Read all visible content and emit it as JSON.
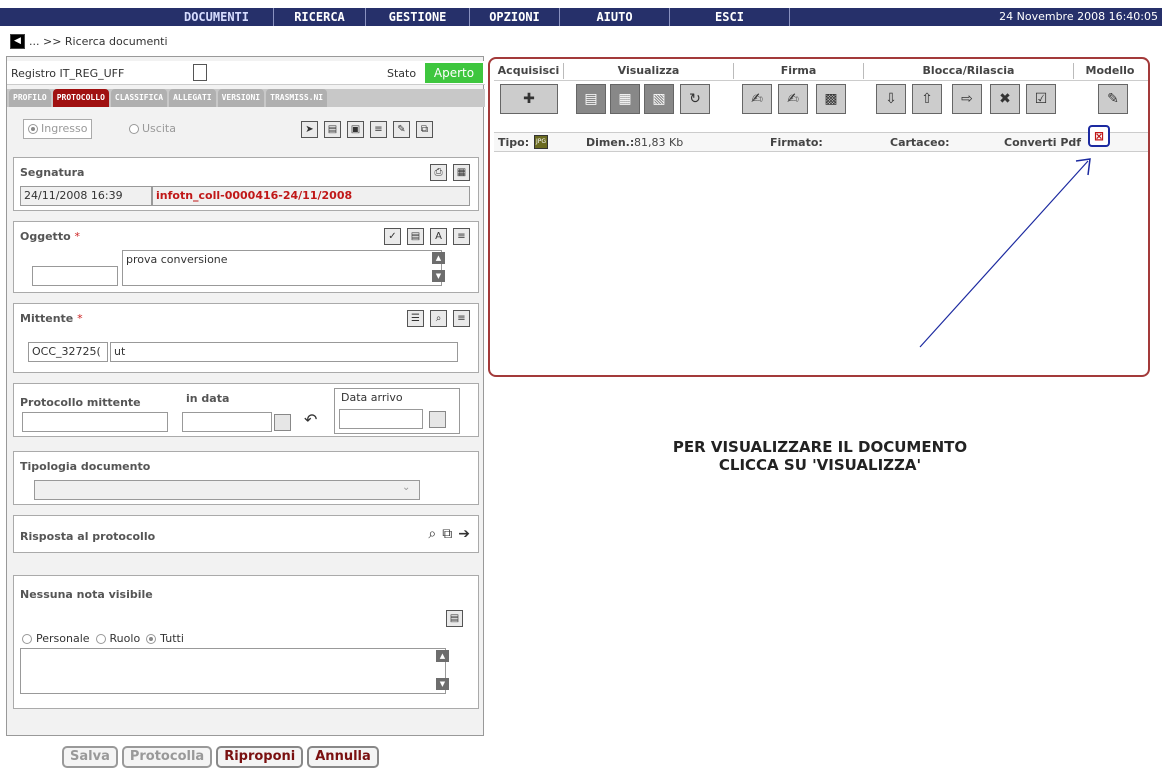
{
  "menu": {
    "items": [
      "DOCUMENTI",
      "RICERCA",
      "GESTIONE",
      "OPZIONI",
      "AIUTO",
      "ESCI"
    ],
    "date": "24 Novembre 2008 16:40:05"
  },
  "breadcrumb": "... >> Ricerca documenti",
  "register": {
    "label": "Registro IT_REG_UFF",
    "stato_label": "Stato",
    "stato_value": "Aperto"
  },
  "tabs": [
    "PROFILO",
    "PROTOCOLLO",
    "CLASSIFICA",
    "ALLEGATI",
    "VERSIONI",
    "TRASMISS.NI"
  ],
  "direction": {
    "ingresso": "Ingresso",
    "uscita": "Uscita"
  },
  "segnatura": {
    "title": "Segnatura",
    "date": "24/11/2008 16:39",
    "code": "infotn_coll-0000416-24/11/2008"
  },
  "oggetto": {
    "title": "Oggetto",
    "required": "*",
    "value": "prova conversione"
  },
  "mittente": {
    "title": "Mittente",
    "required": "*",
    "code": "OCC_32725(",
    "name": "ut"
  },
  "protocollo_mittente": {
    "title": "Protocollo mittente",
    "in_data": "in data",
    "data_arrivo": "Data arrivo"
  },
  "tipologia": {
    "title": "Tipologia documento"
  },
  "risposta": {
    "title": "Risposta al protocollo"
  },
  "note": {
    "title": "Nessuna nota visibile",
    "options": [
      "Personale",
      "Ruolo",
      "Tutti"
    ],
    "selected": "Tutti"
  },
  "buttons": [
    "Salva",
    "Protocolla",
    "Riproponi",
    "Annulla"
  ],
  "toolbar_groups": [
    "Acquisisci",
    "Visualizza",
    "Firma",
    "Blocca/Rilascia",
    "Modello"
  ],
  "file_info": {
    "tipo": "Tipo:",
    "dimen_label": "Dimen.:",
    "dimen_value": "81,83 Kb",
    "firmato": "Firmato:",
    "cartaceo": "Cartaceo:",
    "converti": "Converti Pdf"
  },
  "message": {
    "line1": "PER VISUALIZZARE IL DOCUMENTO",
    "line2": "CLICCA SU 'VISUALIZZA'"
  },
  "colors": {
    "menu_bg": "#26306a",
    "active_tab": "#a01010",
    "aperto": "#3ec63e",
    "frame": "#a33a3a",
    "annotation": "#1c2aa0"
  }
}
